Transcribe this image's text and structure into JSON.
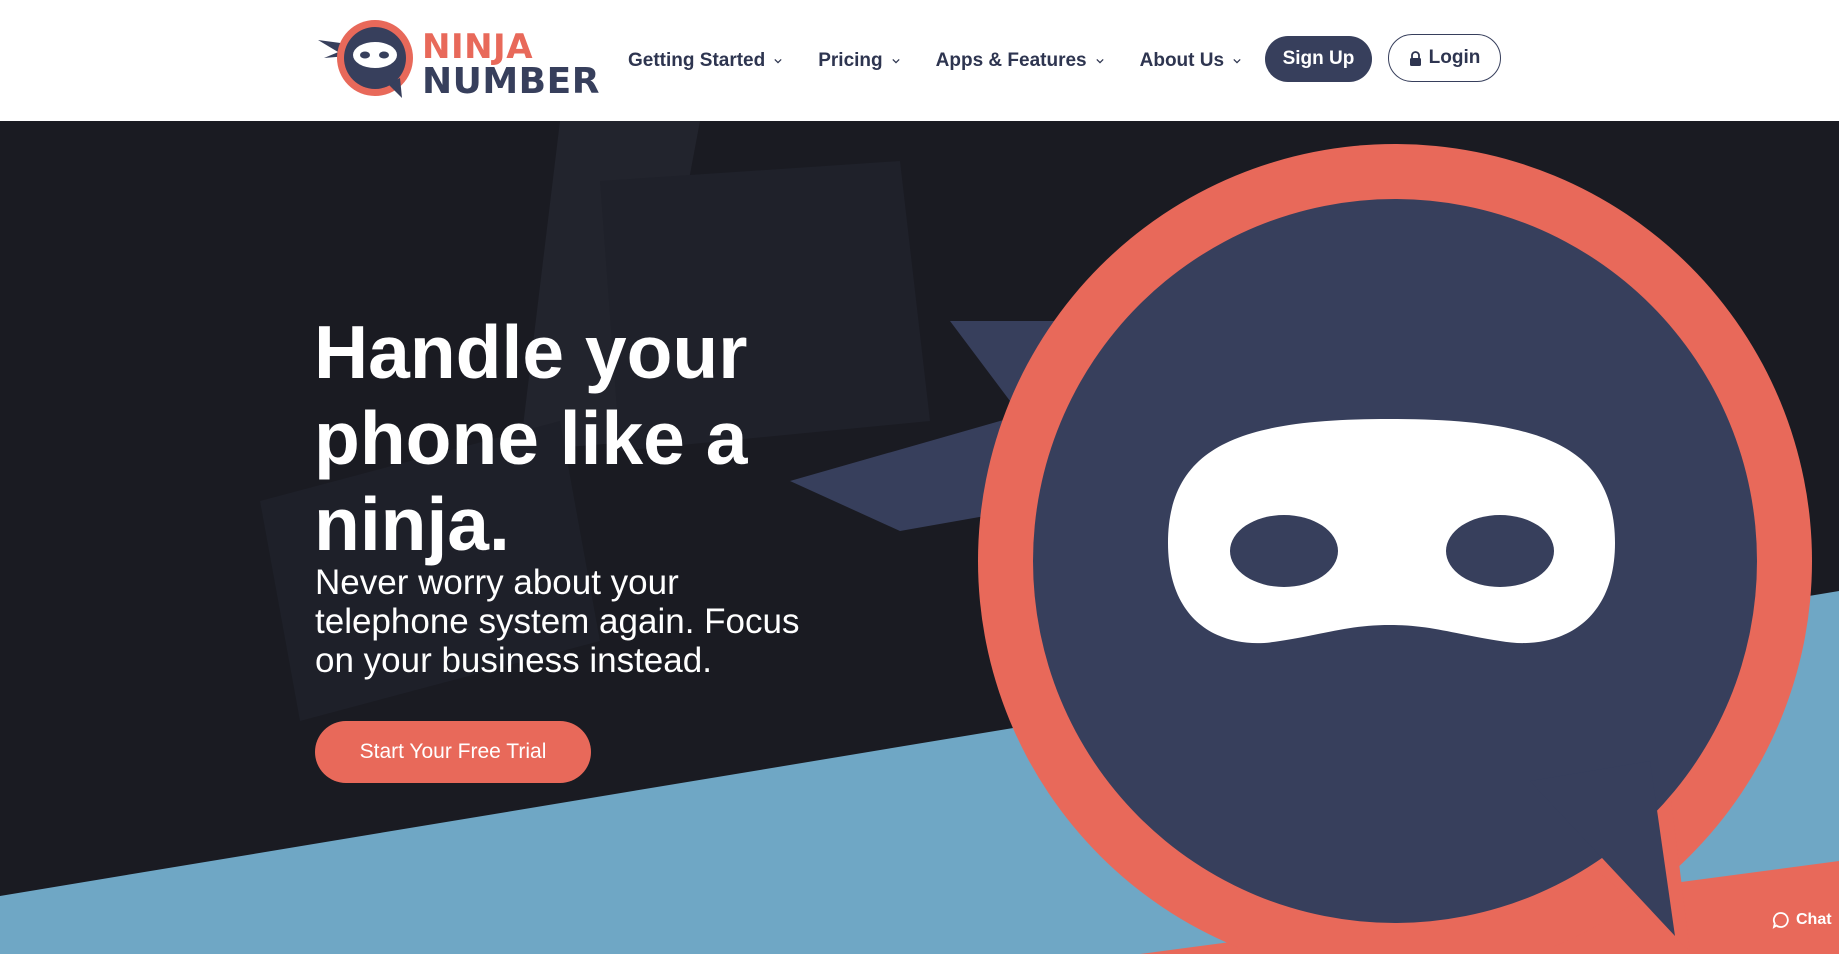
{
  "brand": {
    "line1": "NINJA",
    "line2": "NUMBER",
    "colors": {
      "coral": "#e8695a",
      "navy": "#373f5c",
      "sky": "#6fa7c5",
      "dark": "#1a1b22"
    }
  },
  "nav": {
    "items": [
      {
        "label": "Getting Started",
        "icon": "chevron-down-icon"
      },
      {
        "label": "Pricing",
        "icon": "chevron-down-icon"
      },
      {
        "label": "Apps & Features",
        "icon": "chevron-down-icon"
      },
      {
        "label": "About Us",
        "icon": "chevron-down-icon"
      }
    ],
    "signup_label": "Sign Up",
    "login_label": "Login",
    "login_icon": "lock-icon"
  },
  "hero": {
    "title": "Handle your phone like a ninja.",
    "subtitle": "Never worry about your telephone system again. Focus on your business instead.",
    "cta_label": "Start Your Free Trial",
    "illustration": "ninja-speech-bubble-icon"
  },
  "chat": {
    "label": "Chat",
    "icon": "chat-bubble-icon"
  }
}
